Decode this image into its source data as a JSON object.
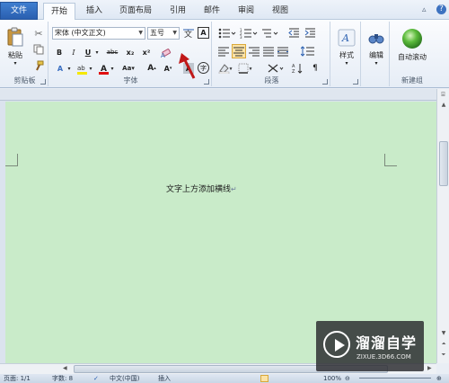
{
  "tabs": [
    {
      "label": "文件"
    },
    {
      "label": "开始"
    },
    {
      "label": "插入"
    },
    {
      "label": "页面布局"
    },
    {
      "label": "引用"
    },
    {
      "label": "邮件"
    },
    {
      "label": "审阅"
    },
    {
      "label": "视图"
    }
  ],
  "window_controls": {
    "minimize": "▵",
    "help": "?"
  },
  "clipboard": {
    "paste_label": "粘贴",
    "group_label": "剪贴板"
  },
  "font": {
    "font_name": "宋体 (中文正文)",
    "font_size": "五号",
    "bold": "B",
    "italic": "I",
    "underline": "U",
    "strike": "abc",
    "subscript": "x₂",
    "superscript": "x²",
    "phonetic_a": "A",
    "group_label": "字体"
  },
  "paragraph": {
    "group_label": "段落"
  },
  "styles": {
    "label": "样式"
  },
  "editing": {
    "label": "编辑"
  },
  "new_group": {
    "button_label": "自动滚动",
    "group_label": "新建组"
  },
  "document": {
    "text": "文字上方添加横线",
    "para_mark": "↵"
  },
  "status": {
    "page": "页面: 1/1",
    "words": "字数: 8",
    "language": "中文(中国)",
    "insert": "插入",
    "zoom": "100%"
  },
  "watermark": {
    "title": "溜溜自学",
    "subtitle": "ZIXUE.3D66.COM"
  },
  "colors": {
    "accent": "#2a5fb0",
    "page_bg": "#c9ebc9",
    "arrow": "#c01818"
  }
}
